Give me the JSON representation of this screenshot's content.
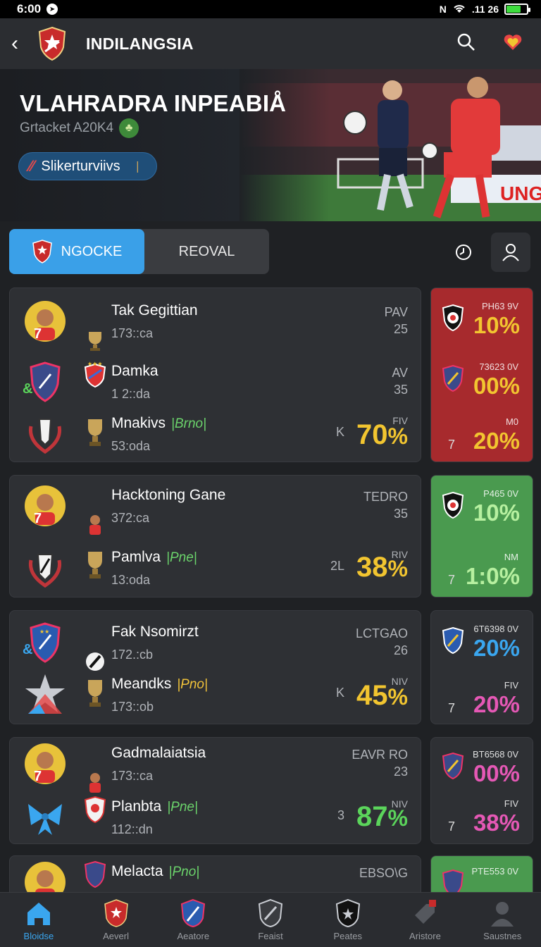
{
  "status": {
    "time": "6:00",
    "network": "N",
    "signal_text": ".11 26"
  },
  "header": {
    "title": "INDILANGSIA"
  },
  "hero": {
    "title": "VLAHRADRA INPEABIÅ",
    "subtitle": "Grtacket A20K4",
    "pill_label": "Slikerturviivs"
  },
  "tabs": [
    {
      "label": "NGOCKE",
      "active": true
    },
    {
      "label": "REOVAL",
      "active": false
    }
  ],
  "cards": [
    {
      "rows": [
        {
          "name": "Tak Gegittian",
          "meta": "173::ca",
          "code_top": "PAV",
          "code_num": "25"
        },
        {
          "name": "Damka",
          "meta": "1 2::da",
          "code_top": "AV",
          "code_num": "35"
        },
        {
          "name": "Mnakivs",
          "tag": "|Brno|",
          "meta": "53:oda",
          "code_top": "FIV",
          "prefix": "K",
          "pct": "70",
          "pct_color": "#f2c530"
        }
      ],
      "side": [
        {
          "code": "PH63 9V",
          "pct": "10",
          "color": "#f2c530"
        },
        {
          "code": "73623 0V",
          "pct": "00",
          "color": "#f2c530"
        },
        {
          "code": "M0",
          "pct": "20",
          "color": "#f2c530",
          "seven": "7"
        }
      ]
    },
    {
      "rows": [
        {
          "name": "Hacktoning Gane",
          "meta": "372:ca",
          "code_top": "TEDRO",
          "code_num": "35"
        },
        {
          "name": "Pamlva",
          "tag": "|Pne|",
          "meta": "13:oda",
          "code_top": "RIV",
          "prefix": "2L",
          "pct": "38",
          "pct_color": "#f2c530"
        }
      ],
      "side": [
        {
          "code": "P465 0V",
          "pct": "10",
          "color": "#b7f0a0"
        },
        {
          "code": "NM",
          "pct": "1:0",
          "color": "#b7f0a0",
          "seven": "7"
        }
      ]
    },
    {
      "rows": [
        {
          "name": "Fak Nsomirzt",
          "meta": "172.:cb",
          "code_top": "LCTGAO",
          "code_num": "26"
        },
        {
          "name": "Meandks",
          "tag": "|Pno|",
          "meta": "173::ob",
          "code_top": "NIV",
          "prefix": "K",
          "pct": "45",
          "pct_color": "#f2c530"
        }
      ],
      "side": [
        {
          "code": "6T6398 0V",
          "pct": "20",
          "color": "#3aa6ef"
        },
        {
          "code": "FIV",
          "pct": "20",
          "color": "#e558b5",
          "seven": "7"
        }
      ]
    },
    {
      "rows": [
        {
          "name": "Gadmalaiatsia",
          "meta": "173::ca",
          "code_top": "EAVR RO",
          "code_num": "23"
        },
        {
          "name": "Planbta",
          "tag": "|Pne|",
          "meta": "112::dn",
          "code_top": "NIV",
          "prefix": "3",
          "pct": "87",
          "pct_color": "#5bd45b"
        }
      ],
      "side": [
        {
          "code": "BT6568 0V",
          "pct": "00",
          "color": "#e558b5"
        },
        {
          "code": "FIV",
          "pct": "38",
          "color": "#e558b5",
          "seven": "7"
        }
      ]
    },
    {
      "rows": [
        {
          "name": "Melacta",
          "tag": "|Pno|",
          "meta": "",
          "code_top": "EBSO\\G",
          "code_num": ""
        }
      ],
      "side": [
        {
          "code": "PTE553 0V",
          "pct": "",
          "color": "#e558b5"
        }
      ]
    }
  ],
  "bottom_nav": [
    {
      "label": "Bloidse",
      "icon": "home-icon",
      "active": true
    },
    {
      "label": "Aeverl",
      "icon": "shield-icon",
      "active": false
    },
    {
      "label": "Aeatore",
      "icon": "crest-icon",
      "active": false
    },
    {
      "label": "Feaist",
      "icon": "badge-icon",
      "active": false
    },
    {
      "label": "Peates",
      "icon": "emblem-icon",
      "active": false
    },
    {
      "label": "Aristore",
      "icon": "tag-icon",
      "active": false
    },
    {
      "label": "Saustnes",
      "icon": "profile-icon",
      "active": false
    }
  ],
  "colors": {
    "accent": "#3aa0e8",
    "red_side": "#a72a2d",
    "green_side": "#4a9a4f"
  }
}
